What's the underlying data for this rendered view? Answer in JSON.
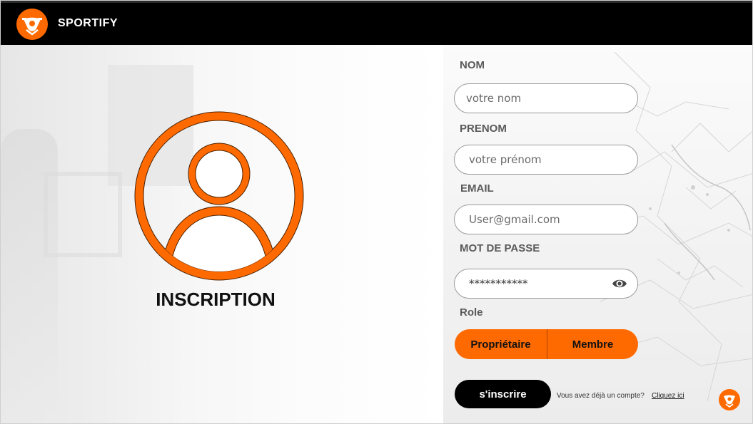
{
  "header": {
    "app_name": "SPORTIFY"
  },
  "page": {
    "title": "INSCRIPTION"
  },
  "form": {
    "nom": {
      "label": "NOM",
      "placeholder": "votre nom",
      "value": ""
    },
    "prenom": {
      "label": "PRENOM",
      "placeholder": "votre prénom",
      "value": ""
    },
    "email": {
      "label": "EMAIL",
      "placeholder": "User@gmail.com",
      "value": ""
    },
    "password": {
      "label": "MOT DE PASSE",
      "value": "***********",
      "toggle_icon": "eye-icon"
    },
    "role": {
      "label": "Role",
      "options": [
        "Propriétaire",
        "Membre"
      ]
    },
    "submit_label": "s'inscrire",
    "login_prompt": "Vous avez déjà un compte?",
    "login_link": "Cliquez ici"
  },
  "colors": {
    "accent": "#ff6a00",
    "header_bg": "#000000",
    "button_dark": "#000000"
  }
}
